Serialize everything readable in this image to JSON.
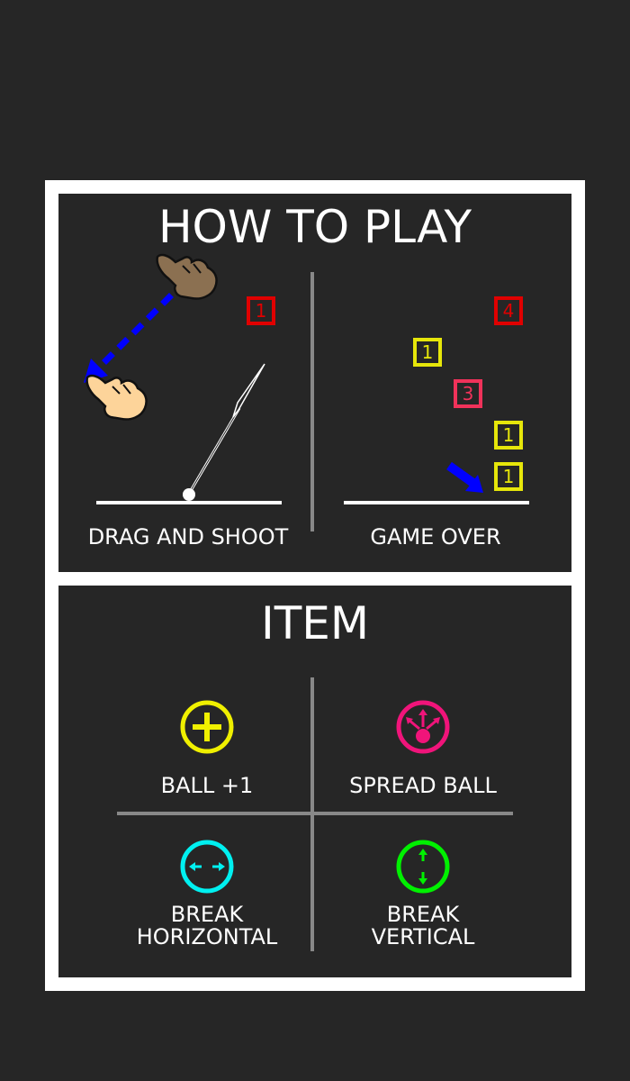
{
  "how_to_play": {
    "title": "HOW TO PLAY",
    "left": {
      "caption": "DRAG AND SHOOT",
      "block": {
        "number": "1",
        "color": "#e00000"
      }
    },
    "right": {
      "caption": "GAME OVER",
      "blocks": [
        {
          "number": "4",
          "color": "#e00000"
        },
        {
          "number": "1",
          "color": "#e6e60a"
        },
        {
          "number": "3",
          "color": "#f0325a"
        },
        {
          "number": "1",
          "color": "#e6e60a"
        },
        {
          "number": "1",
          "color": "#e6e60a"
        }
      ]
    }
  },
  "items": {
    "title": "ITEM",
    "list": [
      {
        "label": "BALL +1",
        "icon": "plus-circle-icon",
        "color": "#f0f000"
      },
      {
        "label": "SPREAD BALL",
        "icon": "spread-ball-icon",
        "color": "#f0147a"
      },
      {
        "label_line1": "BREAK",
        "label_line2": "HORIZONTAL",
        "icon": "horizontal-arrows-icon",
        "color": "#00f0f0"
      },
      {
        "label_line1": "BREAK",
        "label_line2": "VERTICAL",
        "icon": "vertical-arrows-icon",
        "color": "#00f000"
      }
    ]
  }
}
